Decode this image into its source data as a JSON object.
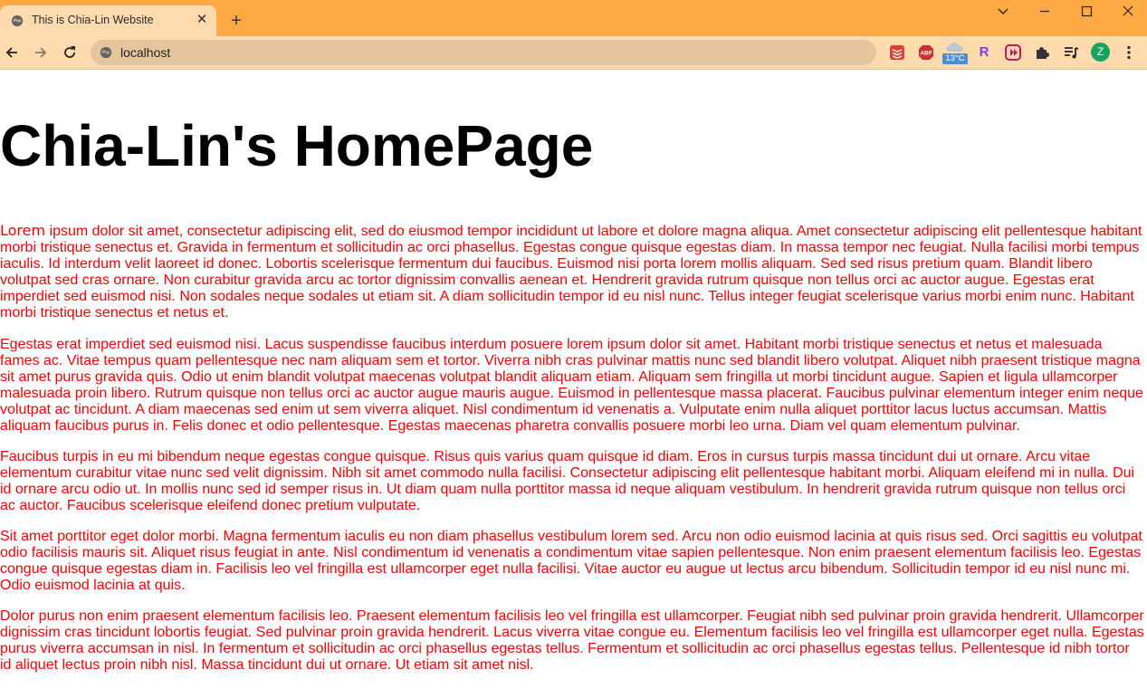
{
  "browser": {
    "tab_title": "This is Chia-Lin Website",
    "tab_close": "✕",
    "new_tab": "+",
    "url": "localhost",
    "weather_temp": "13°C",
    "ext_r_letter": "R",
    "profile_letter": "Z",
    "colors": {
      "titlebar": "#FFA945",
      "toolbar": "#FDDBAF",
      "omnibox": "#E5C59C"
    }
  },
  "page": {
    "heading": "Chia-Lin's HomePage",
    "para1_first_word": "Lorem",
    "para1_rest": " ipsum dolor sit amet, consectetur adipiscing elit, sed do eiusmod tempor incididunt ut labore et dolore magna aliqua. Amet consectetur adipiscing elit pellentesque habitant morbi tristique senectus et. Gravida in fermentum et sollicitudin ac orci phasellus. Egestas congue quisque egestas diam. In massa tempor nec feugiat. Nulla facilisi morbi tempus iaculis. Id interdum velit laoreet id donec. Lobortis scelerisque fermentum dui faucibus. Euismod nisi porta lorem mollis aliquam. Sed sed risus pretium quam. Blandit libero volutpat sed cras ornare. Non curabitur gravida arcu ac tortor dignissim convallis aenean et. Hendrerit gravida rutrum quisque non tellus orci ac auctor augue. Egestas erat imperdiet sed euismod nisi. Non sodales neque sodales ut etiam sit. A diam sollicitudin tempor id eu nisl nunc. Tellus integer feugiat scelerisque varius morbi enim nunc. Habitant morbi tristique senectus et netus et.",
    "para2": "Egestas erat imperdiet sed euismod nisi. Lacus suspendisse faucibus interdum posuere lorem ipsum dolor sit amet. Habitant morbi tristique senectus et netus et malesuada fames ac. Vitae tempus quam pellentesque nec nam aliquam sem et tortor. Viverra nibh cras pulvinar mattis nunc sed blandit libero volutpat. Aliquet nibh praesent tristique magna sit amet purus gravida quis. Odio ut enim blandit volutpat maecenas volutpat blandit aliquam etiam. Aliquam sem fringilla ut morbi tincidunt augue. Sapien et ligula ullamcorper malesuada proin libero. Rutrum quisque non tellus orci ac auctor augue mauris augue. Euismod in pellentesque massa placerat. Faucibus pulvinar elementum integer enim neque volutpat ac tincidunt. A diam maecenas sed enim ut sem viverra aliquet. Nisl condimentum id venenatis a. Vulputate enim nulla aliquet porttitor lacus luctus accumsan. Mattis aliquam faucibus purus in. Felis donec et odio pellentesque. Egestas maecenas pharetra convallis posuere morbi leo urna. Diam vel quam elementum pulvinar.",
    "para3": "Faucibus turpis in eu mi bibendum neque egestas congue quisque. Risus quis varius quam quisque id diam. Eros in cursus turpis massa tincidunt dui ut ornare. Arcu vitae elementum curabitur vitae nunc sed velit dignissim. Nibh sit amet commodo nulla facilisi. Consectetur adipiscing elit pellentesque habitant morbi. Aliquam eleifend mi in nulla. Dui id ornare arcu odio ut. In mollis nunc sed id semper risus in. Ut diam quam nulla porttitor massa id neque aliquam vestibulum. In hendrerit gravida rutrum quisque non tellus orci ac auctor. Faucibus scelerisque eleifend donec pretium vulputate.",
    "para4": "Sit amet porttitor eget dolor morbi. Magna fermentum iaculis eu non diam phasellus vestibulum lorem sed. Arcu non odio euismod lacinia at quis risus sed. Orci sagittis eu volutpat odio facilisis mauris sit. Aliquet risus feugiat in ante. Nisl condimentum id venenatis a condimentum vitae sapien pellentesque. Non enim praesent elementum facilisis leo. Egestas congue quisque egestas diam in. Facilisis leo vel fringilla est ullamcorper eget nulla facilisi. Vitae auctor eu augue ut lectus arcu bibendum. Sollicitudin tempor id eu nisl nunc mi. Odio euismod lacinia at quis.",
    "para5": "Dolor purus non enim praesent elementum facilisis leo. Praesent elementum facilisis leo vel fringilla est ullamcorper. Feugiat nibh sed pulvinar proin gravida hendrerit. Ullamcorper dignissim cras tincidunt lobortis feugiat. Sed pulvinar proin gravida hendrerit. Lacus viverra vitae congue eu. Elementum facilisis leo vel fringilla est ullamcorper eget nulla. Egestas purus viverra accumsan in nisl. In fermentum et sollicitudin ac orci phasellus egestas tellus. Fermentum et sollicitudin ac orci phasellus egestas tellus. Pellentesque id nibh tortor id aliquet lectus proin nibh nisl. Massa tincidunt dui ut ornare. Ut etiam sit amet nisl.",
    "text_color": "#ff0000"
  }
}
